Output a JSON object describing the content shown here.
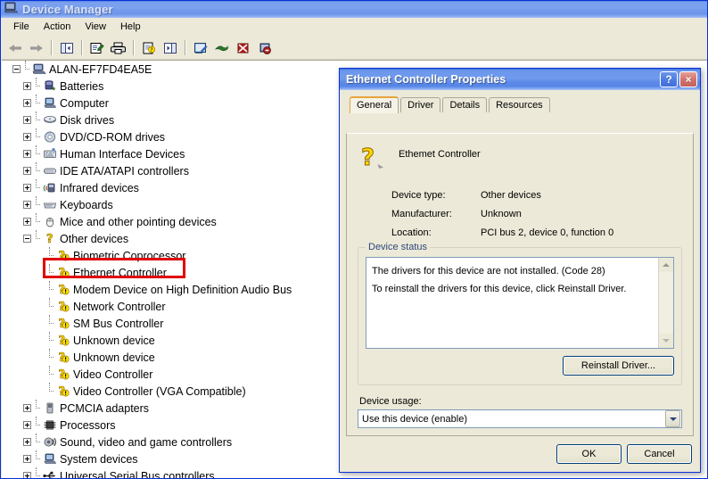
{
  "window": {
    "title": "Device Manager",
    "icon": "device-manager-icon",
    "menu": [
      "File",
      "Action",
      "View",
      "Help"
    ],
    "toolbar": [
      {
        "name": "back-button",
        "glyph": "←"
      },
      {
        "name": "forward-button",
        "glyph": "→"
      },
      {
        "name": "show-hide-console-tree-button",
        "glyph": "tree-pane-icon"
      },
      {
        "name": "properties-button",
        "glyph": "properties-icon"
      },
      {
        "name": "print-button",
        "glyph": "printer-icon"
      },
      {
        "name": "help-button",
        "glyph": "help-doc-icon"
      },
      {
        "name": "show-hide-action-pane-button",
        "glyph": "action-pane-icon"
      },
      {
        "name": "scan-for-hardware-changes-button",
        "glyph": "scan-hardware-icon"
      },
      {
        "name": "update-driver-button",
        "glyph": "update-driver-icon"
      },
      {
        "name": "disable-device-button",
        "glyph": "disable-device-icon"
      },
      {
        "name": "uninstall-device-button",
        "glyph": "uninstall-device-icon"
      }
    ]
  },
  "tree": {
    "root": {
      "label": "ALAN-EF7FD4EA5E",
      "icon": "computer-icon",
      "state": "expanded"
    },
    "items": [
      {
        "label": "Batteries",
        "icon": "battery-icon",
        "state": "collapsed",
        "level": 1
      },
      {
        "label": "Computer",
        "icon": "computer-icon",
        "state": "collapsed",
        "level": 1
      },
      {
        "label": "Disk drives",
        "icon": "disk-drive-icon",
        "state": "collapsed",
        "level": 1
      },
      {
        "label": "DVD/CD-ROM drives",
        "icon": "dvd-drive-icon",
        "state": "collapsed",
        "level": 1
      },
      {
        "label": "Human Interface Devices",
        "icon": "hid-icon",
        "state": "collapsed",
        "level": 1
      },
      {
        "label": "IDE ATA/ATAPI controllers",
        "icon": "ide-controller-icon",
        "state": "collapsed",
        "level": 1
      },
      {
        "label": "Infrared devices",
        "icon": "infrared-icon",
        "state": "collapsed",
        "level": 1
      },
      {
        "label": "Keyboards",
        "icon": "keyboard-icon",
        "state": "collapsed",
        "level": 1
      },
      {
        "label": "Mice and other pointing devices",
        "icon": "mouse-icon",
        "state": "collapsed",
        "level": 1
      },
      {
        "label": "Other devices",
        "icon": "unknown-device-icon",
        "state": "expanded",
        "level": 1
      },
      {
        "label": "Biometric Coprocessor",
        "icon": "unknown-device-warning-icon",
        "state": "leaf",
        "level": 2
      },
      {
        "label": "Ethernet Controller",
        "icon": "unknown-device-warning-icon",
        "state": "leaf",
        "level": 2,
        "highlighted": true
      },
      {
        "label": "Modem Device on High Definition Audio Bus",
        "icon": "unknown-device-warning-icon",
        "state": "leaf",
        "level": 2
      },
      {
        "label": "Network Controller",
        "icon": "unknown-device-warning-icon",
        "state": "leaf",
        "level": 2
      },
      {
        "label": "SM Bus Controller",
        "icon": "unknown-device-warning-icon",
        "state": "leaf",
        "level": 2
      },
      {
        "label": "Unknown device",
        "icon": "unknown-device-warning-icon",
        "state": "leaf",
        "level": 2
      },
      {
        "label": "Unknown device",
        "icon": "unknown-device-warning-icon",
        "state": "leaf",
        "level": 2
      },
      {
        "label": "Video Controller",
        "icon": "unknown-device-warning-icon",
        "state": "leaf",
        "level": 2
      },
      {
        "label": "Video Controller (VGA Compatible)",
        "icon": "unknown-device-warning-icon",
        "state": "leaf",
        "level": 2
      },
      {
        "label": "PCMCIA adapters",
        "icon": "pcmcia-icon",
        "state": "collapsed",
        "level": 1
      },
      {
        "label": "Processors",
        "icon": "processor-icon",
        "state": "collapsed",
        "level": 1
      },
      {
        "label": "Sound, video and game controllers",
        "icon": "sound-icon",
        "state": "collapsed",
        "level": 1
      },
      {
        "label": "System devices",
        "icon": "system-device-icon",
        "state": "collapsed",
        "level": 1
      },
      {
        "label": "Universal Serial Bus controllers",
        "icon": "usb-icon",
        "state": "collapsed",
        "level": 1
      }
    ]
  },
  "dialog": {
    "title": "Ethernet Controller Properties",
    "help_button": "?",
    "close_button": "×",
    "tabs": [
      {
        "label": "General",
        "active": true
      },
      {
        "label": "Driver",
        "active": false
      },
      {
        "label": "Details",
        "active": false
      },
      {
        "label": "Resources",
        "active": false
      }
    ],
    "general": {
      "device_icon": "unknown-device-large-icon",
      "device_name": "Ethemet Controller",
      "fields": [
        {
          "key": "Device type:",
          "value": "Other devices"
        },
        {
          "key": "Manufacturer:",
          "value": "Unknown"
        },
        {
          "key": "Location:",
          "value": "PCI bus 2, device 0, function 0"
        }
      ],
      "status_group_label": "Device status",
      "status_lines": [
        "The drivers for this device are not installed. (Code 28)",
        "To reinstall the drivers for this device, click Reinstall Driver."
      ],
      "reinstall_button": "Reinstall Driver...",
      "usage_label": "Device usage:",
      "usage_value": "Use this device (enable)"
    },
    "ok_button": "OK",
    "cancel_button": "Cancel"
  },
  "colors": {
    "title_blue": "#6c98ec",
    "chrome": "#ece9d8",
    "highlight_red": "#e00000",
    "warning_yellow": "#ffe000",
    "close_red": "#c4605a"
  }
}
